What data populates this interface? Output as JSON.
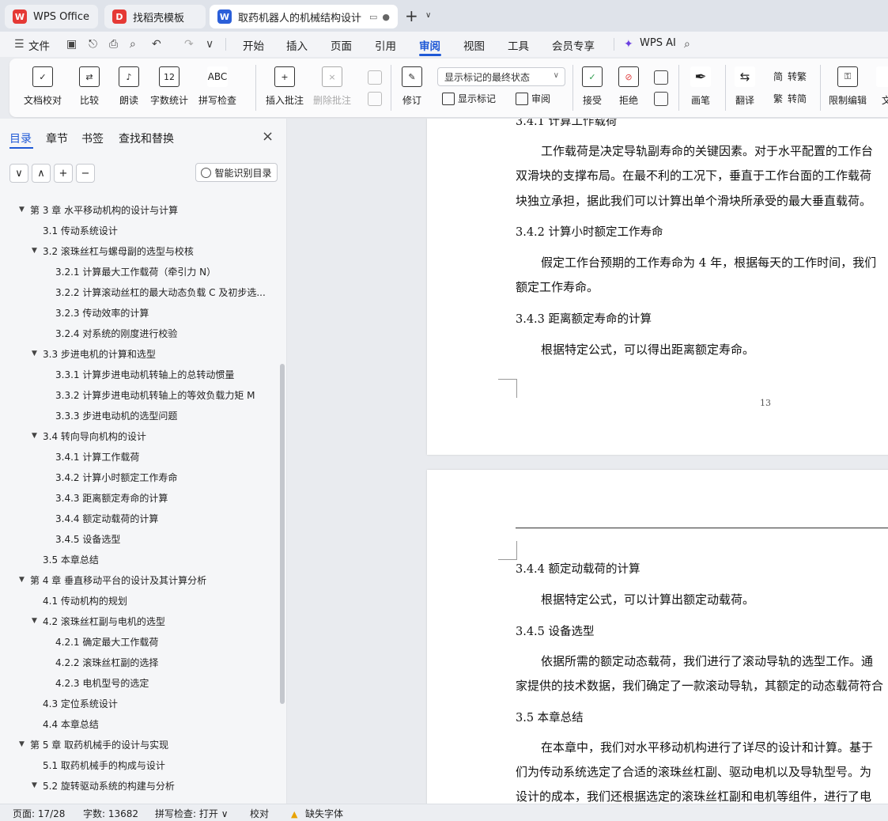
{
  "tabs": [
    {
      "label": "WPS Office",
      "icon": "wps-logo-icon",
      "color": "#e53935"
    },
    {
      "label": "找稻壳模板",
      "icon": "docer-icon",
      "color": "#e53935"
    },
    {
      "label": "取药机器人的机械结构设计 说",
      "icon": "word-doc-icon",
      "color": "#2b5fd9"
    }
  ],
  "menu": {
    "file": "文件",
    "items": [
      "开始",
      "插入",
      "页面",
      "引用",
      "审阅",
      "视图",
      "工具",
      "会员专享"
    ],
    "active": "审阅",
    "ai": "WPS AI"
  },
  "ribbon": {
    "doc_check": "文档校对",
    "compare": "比较",
    "read": "朗读",
    "word_count": "字数统计",
    "spell_check": "拼写检查",
    "insert_comment": "插入批注",
    "delete_comment": "删除批注",
    "revise": "修订",
    "markup_select": "显示标记的最终状态",
    "show_markup": "显示标记",
    "review": "审阅",
    "accept": "接受",
    "reject": "拒绝",
    "pen": "画笔",
    "translate": "翻译",
    "to_traditional": "转繁",
    "to_simplified": "转简",
    "restrict_edit": "限制编辑",
    "doc_partial": "文",
    "word_count_glyph": "12",
    "spell_glyph": "ABC",
    "trad_glyph": "简",
    "simp_glyph": "繁"
  },
  "nav": {
    "tabs": [
      "目录",
      "章节",
      "书签",
      "查找和替换"
    ],
    "active_tab": "目录",
    "smart_toc": "智能识别目录",
    "toc": [
      {
        "level": 1,
        "label": "第 3 章  水平移动机构的设计与计算",
        "expand": "▼"
      },
      {
        "level": 2,
        "label": "3.1  传动系统设计",
        "expand": ""
      },
      {
        "level": 2,
        "label": "3.2  滚珠丝杠与螺母副的选型与校核",
        "expand": "▼"
      },
      {
        "level": 3,
        "label": "3.2.1  计算最大工作载荷（牵引力  N）",
        "expand": ""
      },
      {
        "level": 3,
        "label": "3.2.2  计算滚动丝杠的最大动态负载 C 及初步选...",
        "expand": ""
      },
      {
        "level": 3,
        "label": "3.2.3  传动效率的计算",
        "expand": ""
      },
      {
        "level": 3,
        "label": "3.2.4 对系统的刚度进行校验",
        "expand": ""
      },
      {
        "level": 2,
        "label": "3.3 步进电机的计算和选型",
        "expand": "▼"
      },
      {
        "level": 3,
        "label": "3.3.1 计算步进电动机转轴上的总转动惯量",
        "expand": ""
      },
      {
        "level": 3,
        "label": "3.3.2 计算步进电动机转轴上的等效负载力矩 M",
        "expand": ""
      },
      {
        "level": 3,
        "label": "3.3.3 步进电动机的选型问题",
        "expand": ""
      },
      {
        "level": 2,
        "label": "3.4 转向导向机构的设计",
        "expand": "▼"
      },
      {
        "level": 3,
        "label": "3.4.1 计算工作载荷",
        "expand": ""
      },
      {
        "level": 3,
        "label": "3.4.2 计算小时额定工作寿命",
        "expand": ""
      },
      {
        "level": 3,
        "label": "3.4.3  距离额定寿命的计算",
        "expand": ""
      },
      {
        "level": 3,
        "label": "3.4.4  额定动载荷的计算",
        "expand": ""
      },
      {
        "level": 3,
        "label": "3.4.5  设备选型",
        "expand": ""
      },
      {
        "level": 2,
        "label": "3.5  本章总结",
        "expand": ""
      },
      {
        "level": 1,
        "label": "第 4 章  垂直移动平台的设计及其计算分析",
        "expand": "▼"
      },
      {
        "level": 2,
        "label": "4.1  传动机构的规划",
        "expand": ""
      },
      {
        "level": 2,
        "label": "4.2  滚珠丝杠副与电机的选型",
        "expand": "▼"
      },
      {
        "level": 3,
        "label": "4.2.1  确定最大工作载荷",
        "expand": ""
      },
      {
        "level": 3,
        "label": "4.2.2  滚珠丝杠副的选择",
        "expand": ""
      },
      {
        "level": 3,
        "label": "4.2.3  电机型号的选定",
        "expand": ""
      },
      {
        "level": 2,
        "label": "4.3  定位系统设计",
        "expand": ""
      },
      {
        "level": 2,
        "label": "4.4  本章总结",
        "expand": ""
      },
      {
        "level": 1,
        "label": "第 5 章  取药机械手的设计与实现",
        "expand": "▼"
      },
      {
        "level": 2,
        "label": "5.1  取药机械手的构成与设计",
        "expand": ""
      },
      {
        "level": 2,
        "label": "5.2  旋转驱动系统的构建与分析",
        "expand": "▼"
      }
    ]
  },
  "doc": {
    "page1": {
      "heading_top": "3.4.1 计算工作载荷",
      "p1_l1": "工作载荷是决定导轨副寿命的关键因素。对于水平配置的工作台",
      "p1_l2": "双滑块的支撑布局。在最不利的工况下，垂直于工作台面的工作载荷",
      "p1_l3": "块独立承担，据此我们可以计算出单个滑块所承受的最大垂直载荷。",
      "h2": "3.4.2 计算小时额定工作寿命",
      "p2_l1": "假定工作台预期的工作寿命为 4 年，根据每天的工作时间，我们",
      "p2_l2": "额定工作寿命。",
      "h3": "3.4.3  距离额定寿命的计算",
      "p3_l1": "根据特定公式，可以得出距离额定寿命。",
      "page_number": "13"
    },
    "page2": {
      "h4": "3.4.4  额定动载荷的计算",
      "p4_l1": "根据特定公式，可以计算出额定动载荷。",
      "h5": "3.4.5  设备选型",
      "p5_l1": "依据所需的额定动态载荷，我们进行了滚动导轨的选型工作。通",
      "p5_l2": "家提供的技术数据，我们确定了一款滚动导轨，其额定的动态载荷符合",
      "h6": "3.5  本章总结",
      "p6_l1": "在本章中，我们对水平移动机构进行了详尽的设计和计算。基于",
      "p6_l2": "们为传动系统选定了合适的滚珠丝杠副、驱动电机以及导轨型号。为",
      "p6_l3": "设计的成本，我们还根据选定的滚珠丝杠副和电机等组件，进行了电"
    }
  },
  "status": {
    "page": "页面: 17/28",
    "words": "字数: 13682",
    "spell": "拼写检查: 打开",
    "proof": "校对",
    "missing_font": "缺失字体"
  }
}
